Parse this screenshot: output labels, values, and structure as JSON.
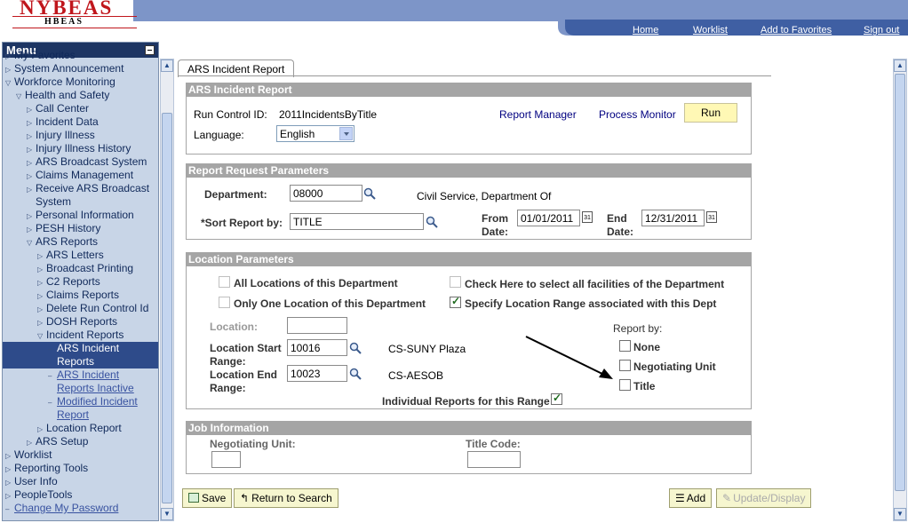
{
  "header": {
    "logo_main": "NYBEAS",
    "logo_sub": "HBEAS",
    "links": [
      "Home",
      "Worklist",
      "Add to Favorites",
      "Sign out"
    ]
  },
  "menu": {
    "title": "Menu",
    "items": [
      {
        "label": "My Favorites",
        "indent": 0,
        "tri": "right"
      },
      {
        "label": "System Announcement",
        "indent": 0,
        "tri": "right"
      },
      {
        "label": "Workforce Monitoring",
        "indent": 0,
        "tri": "down"
      },
      {
        "label": "Health and Safety",
        "indent": 1,
        "tri": "down"
      },
      {
        "label": "Call Center",
        "indent": 2,
        "tri": "right"
      },
      {
        "label": "Incident Data",
        "indent": 2,
        "tri": "right"
      },
      {
        "label": "Injury Illness",
        "indent": 2,
        "tri": "right"
      },
      {
        "label": "Injury Illness History",
        "indent": 2,
        "tri": "right"
      },
      {
        "label": "ARS Broadcast System",
        "indent": 2,
        "tri": "right"
      },
      {
        "label": "Claims Management",
        "indent": 2,
        "tri": "right"
      },
      {
        "label": "Receive ARS Broadcast",
        "indent": 2,
        "tri": "right"
      },
      {
        "label": "System",
        "indent": 2,
        "tri": "none"
      },
      {
        "label": "Personal Information",
        "indent": 2,
        "tri": "right"
      },
      {
        "label": "PESH History",
        "indent": 2,
        "tri": "right"
      },
      {
        "label": "ARS Reports",
        "indent": 2,
        "tri": "down"
      },
      {
        "label": "ARS Letters",
        "indent": 3,
        "tri": "right"
      },
      {
        "label": "Broadcast Printing",
        "indent": 3,
        "tri": "right"
      },
      {
        "label": "C2 Reports",
        "indent": 3,
        "tri": "right"
      },
      {
        "label": "Claims Reports",
        "indent": 3,
        "tri": "right"
      },
      {
        "label": "Delete Run Control Id",
        "indent": 3,
        "tri": "right"
      },
      {
        "label": "DOSH Reports",
        "indent": 3,
        "tri": "right"
      },
      {
        "label": "Incident Reports",
        "indent": 3,
        "tri": "down"
      },
      {
        "label": "ARS Incident",
        "indent": 4,
        "tri": "dash",
        "style": "sel"
      },
      {
        "label": "Reports",
        "indent": 4,
        "tri": "none",
        "style": "sel"
      },
      {
        "label": "ARS Incident",
        "indent": 4,
        "tri": "dash",
        "style": "lnk"
      },
      {
        "label": "Reports Inactive",
        "indent": 4,
        "tri": "none",
        "style": "lnk"
      },
      {
        "label": "Modified Incident",
        "indent": 4,
        "tri": "dash",
        "style": "lnk"
      },
      {
        "label": "Report",
        "indent": 4,
        "tri": "none",
        "style": "lnk"
      },
      {
        "label": "Location Report",
        "indent": 3,
        "tri": "right"
      },
      {
        "label": "ARS Setup",
        "indent": 2,
        "tri": "right"
      },
      {
        "label": "Worklist",
        "indent": 0,
        "tri": "right"
      },
      {
        "label": "Reporting Tools",
        "indent": 0,
        "tri": "right"
      },
      {
        "label": "User Info",
        "indent": 0,
        "tri": "right"
      },
      {
        "label": "PeopleTools",
        "indent": 0,
        "tri": "right"
      },
      {
        "label": "Change My Password",
        "indent": 0,
        "tri": "dash",
        "style": "lnk"
      }
    ]
  },
  "tab": {
    "label": "ARS Incident Report"
  },
  "section1": {
    "title": "ARS Incident Report",
    "run_control_label": "Run Control ID:",
    "run_control_value": "2011IncidentsByTitle",
    "report_manager": "Report Manager",
    "process_monitor": "Process Monitor",
    "run_button": "Run",
    "language_label": "Language:",
    "language_value": "English"
  },
  "section2": {
    "title": "Report Request Parameters",
    "department_label": "Department:",
    "department_value": "08000",
    "department_desc": "Civil Service, Department Of",
    "sort_label": "*Sort Report by:",
    "sort_value": "TITLE",
    "from_label": "From",
    "from_label2": "Date:",
    "from_value": "01/01/2011",
    "end_label": "End",
    "end_label2": "Date:",
    "end_value": "12/31/2011",
    "cal_icon": "31"
  },
  "section3": {
    "title": "Location Parameters",
    "all_locations": "All Locations of this Department",
    "check_all_facilities": "Check Here to select all facilities of the Department",
    "only_one": "Only One Location of this Department",
    "specify_range": "Specify Location Range associated with this Dept",
    "location_label": "Location:",
    "start_label": "Location Start",
    "start_label2": "Range:",
    "start_value": "10016",
    "start_desc": "CS-SUNY Plaza",
    "end_label": "Location End",
    "end_label2": "Range:",
    "end_value": "10023",
    "end_desc": "CS-AESOB",
    "individual": "Individual Reports for this Range",
    "report_by_label": "Report by:",
    "report_by_options": [
      "None",
      "Negotiating Unit",
      "Title"
    ]
  },
  "section4": {
    "title": "Job Information",
    "neg_unit_label": "Negotiating Unit:",
    "title_code_label": "Title Code:"
  },
  "buttons": {
    "save": "Save",
    "return_to_search": "Return to Search",
    "add": "Add",
    "update_display": "Update/Display"
  },
  "colors": {
    "header_band": "#3f5fa3",
    "menu_bg": "#c8d5e7",
    "menu_title": "#1d3563",
    "section_header": "#a5a5a5",
    "button_bg": "#f6f6cf"
  }
}
